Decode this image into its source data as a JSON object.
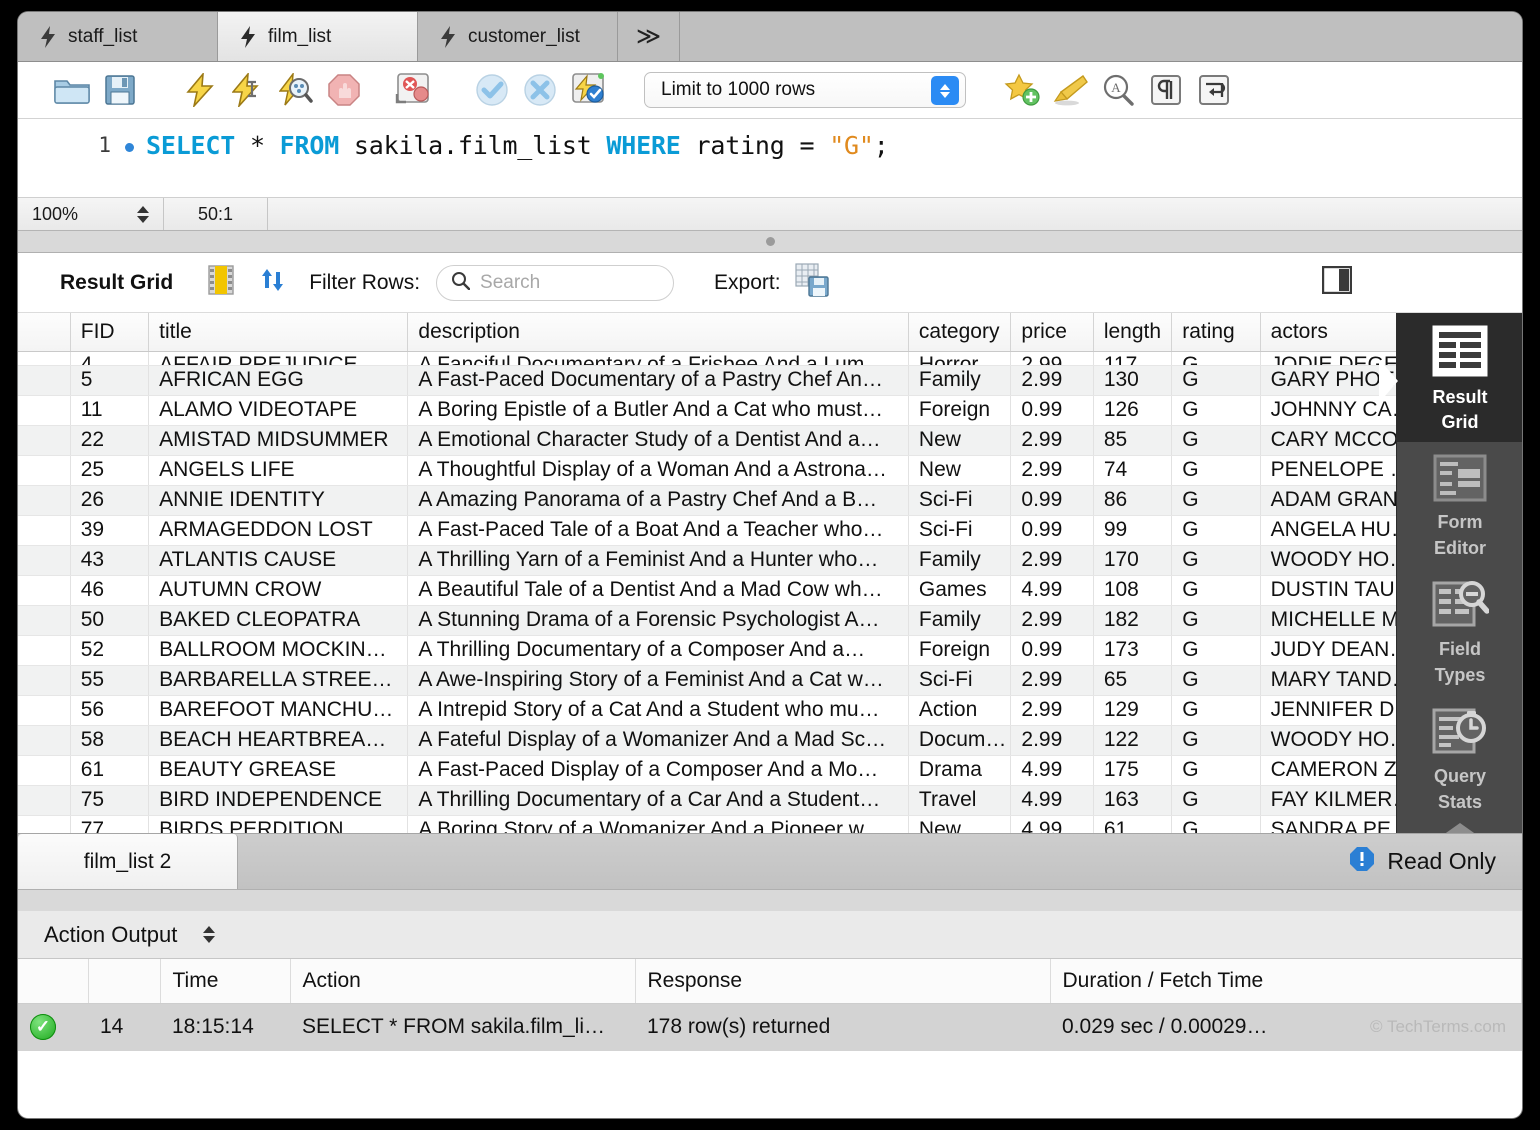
{
  "window": {
    "tabs": [
      {
        "label": "staff_list",
        "icon": "lightning-icon",
        "active": false
      },
      {
        "label": "film_list",
        "icon": "lightning-icon",
        "active": true
      },
      {
        "label": "customer_list",
        "icon": "lightning-icon",
        "active": false
      }
    ],
    "more_tabs_label": "≫"
  },
  "toolbar": {
    "icons": [
      "open-folder-icon",
      "save-icon",
      "execute-icon",
      "execute-current-icon",
      "explain-query-icon",
      "stop-icon",
      "toggle-stop-on-error-icon",
      "commit-icon",
      "rollback-icon",
      "auto-commit-icon"
    ],
    "limit_value": "Limit to 1000 rows",
    "right_icons": [
      "add-snippet-icon",
      "beautify-icon",
      "find-icon",
      "show-invisible-icon",
      "wrap-lines-icon"
    ]
  },
  "editor": {
    "line_number": "1",
    "query_tokens": [
      {
        "t": "SELECT",
        "k": "kw"
      },
      {
        "t": " * ",
        "k": "op"
      },
      {
        "t": "FROM",
        "k": "kw"
      },
      {
        "t": " sakila.film_list ",
        "k": "op"
      },
      {
        "t": "WHERE",
        "k": "kw"
      },
      {
        "t": " rating = ",
        "k": "op"
      },
      {
        "t": "\"G\"",
        "k": "str"
      },
      {
        "t": ";",
        "k": "op"
      }
    ],
    "query_plain": "SELECT * FROM sakila.film_list WHERE rating = \"G\";"
  },
  "zoombar": {
    "zoom": "100%",
    "ratio": "50:1"
  },
  "result_toolbar": {
    "title": "Result Grid",
    "grid_icon": "filmstrip-icon",
    "refresh_icon": "refresh-icon",
    "filter_label": "Filter Rows:",
    "search_placeholder": "Search",
    "search_value": "",
    "search_icon": "magnifier-icon",
    "export_label": "Export:",
    "export_icon": "export-icon",
    "panel_toggle_icon": "toggle-panel-icon"
  },
  "grid": {
    "columns": [
      "FID",
      "title",
      "description",
      "category",
      "price",
      "length",
      "rating",
      "actors"
    ],
    "rows": [
      {
        "fid": "4",
        "title": "AFFAIR PREJUDICE",
        "description": "A Fanciful Documentary of a Frisbee And a Lum…",
        "category": "Horror",
        "price": "2.99",
        "length": "117",
        "rating": "G",
        "actors": "JODIE DEGE…",
        "clipped": true
      },
      {
        "fid": "5",
        "title": "AFRICAN EGG",
        "description": "A Fast-Paced Documentary of a Pastry Chef An…",
        "category": "Family",
        "price": "2.99",
        "length": "130",
        "rating": "G",
        "actors": "GARY PHOEB…"
      },
      {
        "fid": "11",
        "title": "ALAMO VIDEOTAPE",
        "description": "A Boring Epistle of a Butler And a Cat who must…",
        "category": "Foreign",
        "price": "0.99",
        "length": "126",
        "rating": "G",
        "actors": "JOHNNY CA…"
      },
      {
        "fid": "22",
        "title": "AMISTAD MIDSUMMER",
        "description": "A Emotional Character Study of a Dentist And a…",
        "category": "New",
        "price": "2.99",
        "length": "85",
        "rating": "G",
        "actors": "CARY MCCO…"
      },
      {
        "fid": "25",
        "title": "ANGELS LIFE",
        "description": "A Thoughtful Display of a Woman And a Astrona…",
        "category": "New",
        "price": "2.99",
        "length": "74",
        "rating": "G",
        "actors": "PENELOPE …"
      },
      {
        "fid": "26",
        "title": "ANNIE IDENTITY",
        "description": "A Amazing Panorama of a Pastry Chef And a B…",
        "category": "Sci-Fi",
        "price": "0.99",
        "length": "86",
        "rating": "G",
        "actors": "ADAM GRAN…"
      },
      {
        "fid": "39",
        "title": "ARMAGEDDON LOST",
        "description": "A Fast-Paced Tale of a Boat And a Teacher who…",
        "category": "Sci-Fi",
        "price": "0.99",
        "length": "99",
        "rating": "G",
        "actors": "ANGELA HU…"
      },
      {
        "fid": "43",
        "title": "ATLANTIS CAUSE",
        "description": "A Thrilling Yarn of a Feminist And a Hunter who…",
        "category": "Family",
        "price": "2.99",
        "length": "170",
        "rating": "G",
        "actors": "WOODY HO…"
      },
      {
        "fid": "46",
        "title": "AUTUMN CROW",
        "description": "A Beautiful Tale of a Dentist And a Mad Cow wh…",
        "category": "Games",
        "price": "4.99",
        "length": "108",
        "rating": "G",
        "actors": "DUSTIN TAU…"
      },
      {
        "fid": "50",
        "title": "BAKED CLEOPATRA",
        "description": "A Stunning Drama of a Forensic Psychologist A…",
        "category": "Family",
        "price": "2.99",
        "length": "182",
        "rating": "G",
        "actors": "MICHELLE M…"
      },
      {
        "fid": "52",
        "title": "BALLROOM MOCKIN…",
        "description": "A Thrilling Documentary of a Composer And a…",
        "category": "Foreign",
        "price": "0.99",
        "length": "173",
        "rating": "G",
        "actors": "JUDY DEAN…"
      },
      {
        "fid": "55",
        "title": "BARBARELLA STREE…",
        "description": "A Awe-Inspiring Story of a Feminist And a Cat w…",
        "category": "Sci-Fi",
        "price": "2.99",
        "length": "65",
        "rating": "G",
        "actors": "MARY TAND…"
      },
      {
        "fid": "56",
        "title": "BAREFOOT MANCHU…",
        "description": "A Intrepid Story of a Cat And a Student who mu…",
        "category": "Action",
        "price": "2.99",
        "length": "129",
        "rating": "G",
        "actors": "JENNIFER D…"
      },
      {
        "fid": "58",
        "title": "BEACH HEARTBREA…",
        "description": "A Fateful Display of a Womanizer And a Mad Sc…",
        "category": "Docum…",
        "price": "2.99",
        "length": "122",
        "rating": "G",
        "actors": "WOODY HO…"
      },
      {
        "fid": "61",
        "title": "BEAUTY GREASE",
        "description": "A Fast-Paced Display of a Composer And a Mo…",
        "category": "Drama",
        "price": "4.99",
        "length": "175",
        "rating": "G",
        "actors": "CAMERON Z…"
      },
      {
        "fid": "75",
        "title": "BIRD INDEPENDENCE",
        "description": "A Thrilling Documentary of a Car And a Student…",
        "category": "Travel",
        "price": "4.99",
        "length": "163",
        "rating": "G",
        "actors": "FAY KILMER…"
      },
      {
        "fid": "77",
        "title": "BIRDS PERDITION",
        "description": "A Boring Story of a Womanizer And a Pioneer w…",
        "category": "New",
        "price": "4.99",
        "length": "61",
        "rating": "G",
        "actors": "SANDRA PE…"
      }
    ]
  },
  "sidepanel": {
    "items": [
      {
        "label_line1": "Result",
        "label_line2": "Grid",
        "icon": "result-grid-icon",
        "active": true
      },
      {
        "label_line1": "Form",
        "label_line2": "Editor",
        "icon": "form-editor-icon",
        "active": false
      },
      {
        "label_line1": "Field",
        "label_line2": "Types",
        "icon": "field-types-icon",
        "active": false
      },
      {
        "label_line1": "Query",
        "label_line2": "Stats",
        "icon": "query-stats-icon",
        "active": false
      }
    ],
    "scroll_up_icon": "chevron-up-icon",
    "scroll_down_icon": "chevron-down-icon"
  },
  "result_tabs": {
    "tabs": [
      {
        "label": "film_list 2",
        "active": true
      }
    ],
    "readonly_label": "Read Only",
    "readonly_icon": "info-icon"
  },
  "action_output": {
    "title": "Action Output",
    "selector_icon": "stepper-icon",
    "columns": [
      "",
      "",
      "Time",
      "Action",
      "Response",
      "Duration / Fetch Time"
    ],
    "rows": [
      {
        "status_icon": "success-icon",
        "num": "14",
        "time": "18:15:14",
        "action": "SELECT * FROM sakila.film_li…",
        "response": "178 row(s) returned",
        "duration": "0.029 sec / 0.00029…"
      }
    ],
    "watermark": "© TechTerms.com"
  },
  "colors": {
    "accent_blue": "#2b8bf4",
    "keyword": "#0a9bd6",
    "string": "#e08a1e",
    "panel_dark": "#4a4a4a",
    "panel_active": "#2b2b2b",
    "success_green": "#1aa81a"
  }
}
